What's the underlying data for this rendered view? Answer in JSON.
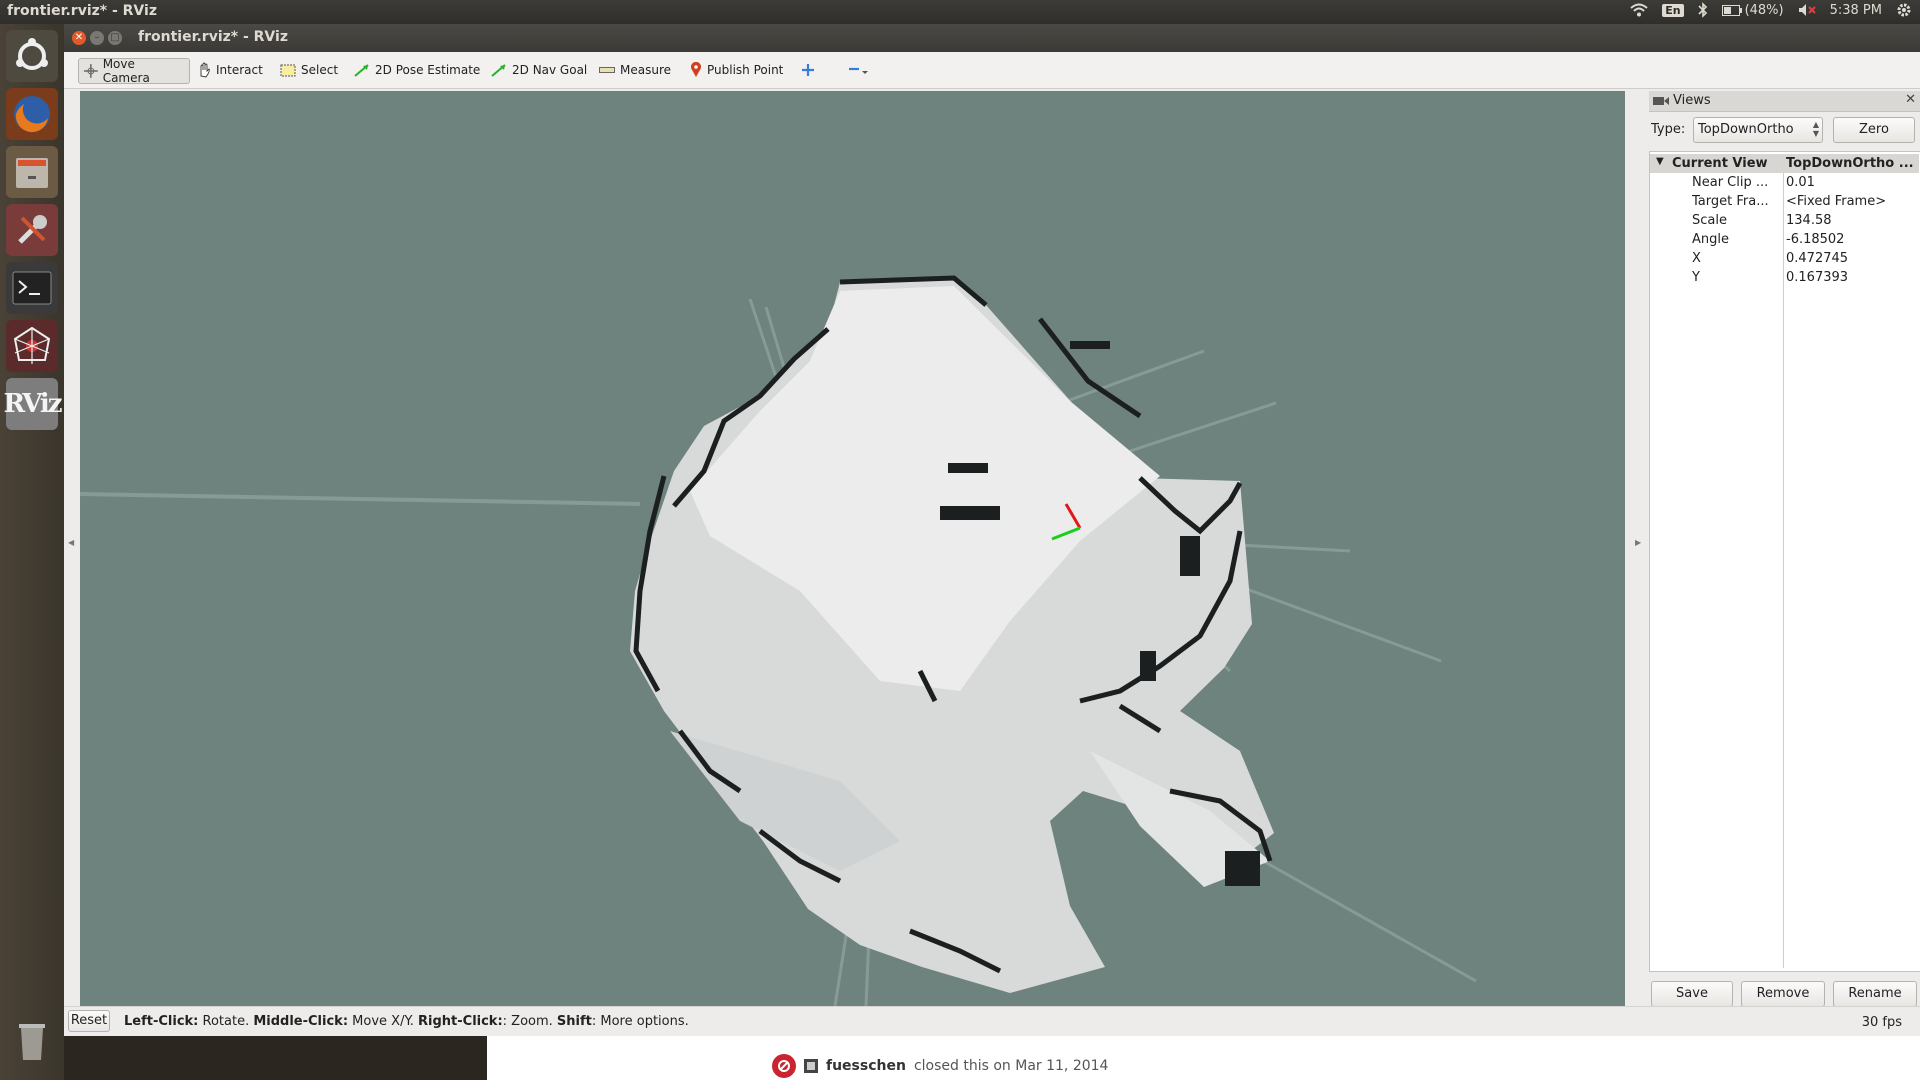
{
  "system_bar": {
    "app_title": "frontier.rviz* - RViz",
    "keyboard_layout": "En",
    "battery": "(48%)",
    "clock": "5:38 PM"
  },
  "window": {
    "title": "frontier.rviz* - RViz"
  },
  "toolbar": {
    "tools": [
      {
        "label": "Move Camera",
        "icon": "move-camera-icon",
        "active": true
      },
      {
        "label": "Interact",
        "icon": "hand-icon"
      },
      {
        "label": "Select",
        "icon": "select-box-icon"
      },
      {
        "label": "2D Pose Estimate",
        "icon": "green-arrow-icon"
      },
      {
        "label": "2D Nav Goal",
        "icon": "green-arrow-icon"
      },
      {
        "label": "Measure",
        "icon": "ruler-icon"
      },
      {
        "label": "Publish Point",
        "icon": "map-pin-icon"
      }
    ]
  },
  "views_panel": {
    "title": "Views",
    "type_label": "Type:",
    "type_value": "TopDownOrtho",
    "zero_button": "Zero",
    "tree": {
      "header_key": "Current View",
      "header_value": "TopDownOrtho ...",
      "rows": [
        {
          "key": "Near Clip ...",
          "value": "0.01"
        },
        {
          "key": "Target Fra...",
          "value": "<Fixed Frame>"
        },
        {
          "key": "Scale",
          "value": "134.58"
        },
        {
          "key": "Angle",
          "value": "-6.18502"
        },
        {
          "key": "X",
          "value": "0.472745"
        },
        {
          "key": "Y",
          "value": "0.167393"
        }
      ]
    },
    "buttons": {
      "save": "Save",
      "remove": "Remove",
      "rename": "Rename"
    }
  },
  "status": {
    "reset": "Reset",
    "left_click": "Left-Click:",
    "left_action": " Rotate. ",
    "middle_click": "Middle-Click:",
    "middle_action": " Move X/Y. ",
    "right_click": "Right-Click:",
    "right_action": ": Zoom. ",
    "shift": "Shift",
    "shift_action": ": More options.",
    "fps": "30 fps"
  },
  "background_page": {
    "user": "fuesschen",
    "text": " closed this on Mar 11, 2014"
  },
  "colors": {
    "viewport_bg": "#6e827e",
    "free_space": "#e6e7e7",
    "occupied": "#1c1f1f"
  }
}
